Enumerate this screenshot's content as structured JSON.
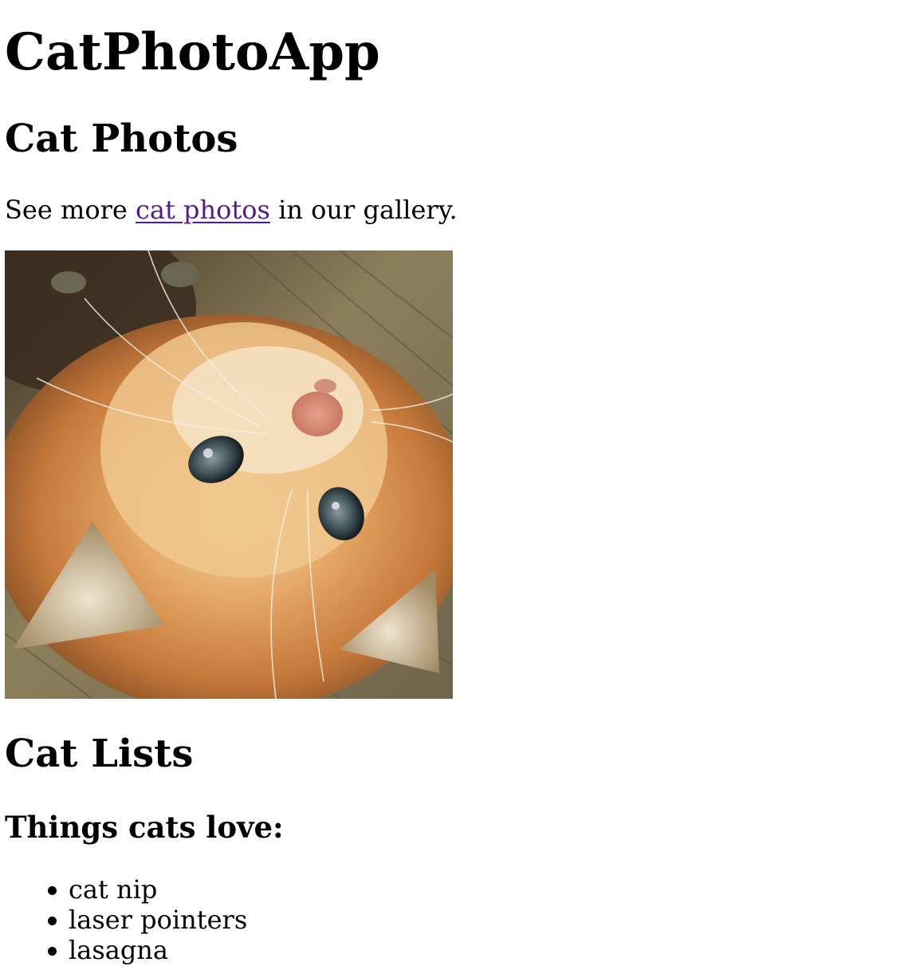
{
  "page": {
    "title": "CatPhotoApp"
  },
  "photos_section": {
    "heading": "Cat Photos",
    "gallery_text_before": "See more ",
    "gallery_link": "cat photos",
    "gallery_text_after": " in our gallery.",
    "image_alt": "A cute orange cat lying on its back."
  },
  "lists_section": {
    "heading": "Cat Lists",
    "subheading": "Things cats love:",
    "items": [
      "cat nip",
      "laser pointers",
      "lasagna"
    ]
  },
  "colors": {
    "link_visited": "#551a8b",
    "text": "#000000",
    "background": "#ffffff"
  }
}
